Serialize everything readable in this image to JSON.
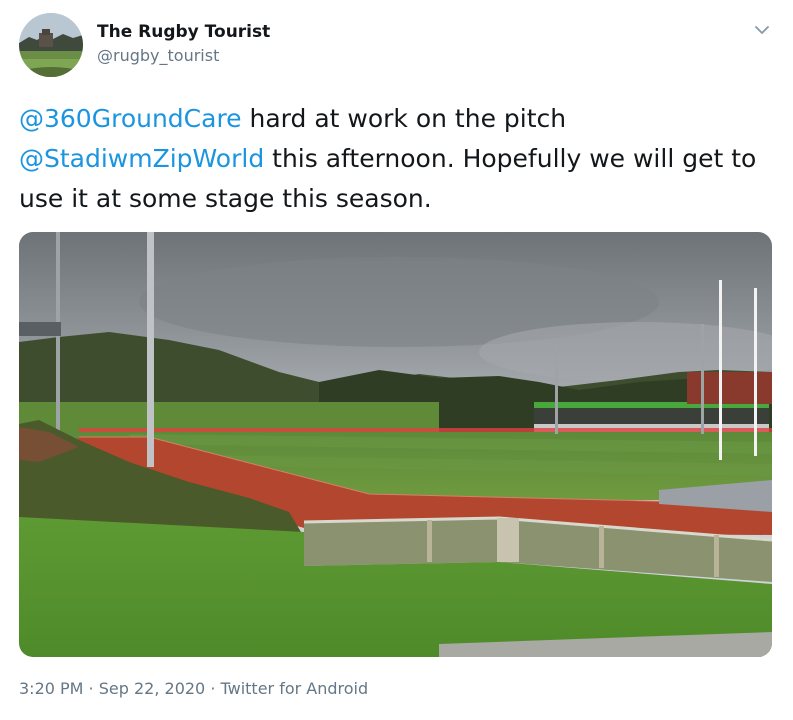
{
  "author": {
    "display_name": "The Rugby Tourist",
    "handle": "@rugby_tourist",
    "avatar_icon": "stadium-avatar-icon"
  },
  "menu": {
    "icon": "chevron-down-icon"
  },
  "tweet": {
    "segments": [
      {
        "type": "mention",
        "text": "@360GroundCare"
      },
      {
        "type": "text",
        "text": " hard at work on the pitch "
      },
      {
        "type": "mention",
        "text": "@StadiwmZipWorld"
      },
      {
        "type": "text",
        "text": " this afternoon. Hopefully we will get to use it at some stage this season."
      }
    ]
  },
  "media": {
    "description_icon": "stadium-photo"
  },
  "meta": {
    "time": "3:20 PM",
    "separator": " · ",
    "date": "Sep 22, 2020",
    "source": "Twitter for Android"
  },
  "colors": {
    "link": "#1b95e0",
    "text": "#14171a",
    "secondary": "#657786"
  }
}
